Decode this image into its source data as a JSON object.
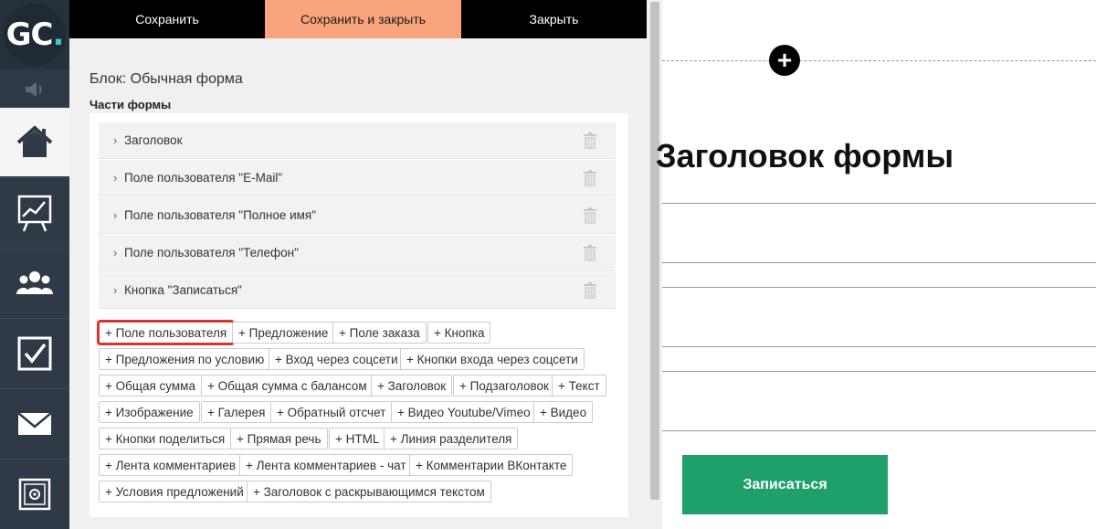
{
  "logo": {
    "text_main": "GC",
    "text_dot": "."
  },
  "tabs": {
    "save": "Сохранить",
    "save_close": "Сохранить и закрыть",
    "close": "Закрыть"
  },
  "block_title": "Блок: Обычная форма",
  "parts_title": "Части формы",
  "parts": [
    "Заголовок",
    "Поле пользователя \"E-Mail\"",
    "Поле пользователя \"Полное имя\"",
    "Поле пользователя \"Телефон\"",
    "Кнопка \"Записаться\""
  ],
  "chips": [
    "+ Поле пользователя",
    "+ Предложение",
    "+ Поле заказа",
    "+ Кнопка",
    "+ Предложения по условию",
    "+ Вход через соцсети",
    "+ Кнопки входа через соцсети",
    "+ Общая сумма",
    "+ Общая сумма с балансом",
    "+ Заголовок",
    "+ Подзаголовок",
    "+ Текст",
    "+ Изображение",
    "+ Галерея",
    "+ Обратный отсчет",
    "+ Видео Youtube/Vimeo",
    "+ Видео",
    "+ Кнопки поделиться",
    "+ Прямая речь",
    "+ HTML",
    "+ Линия разделителя",
    "+ Лента комментариев",
    "+ Лента комментариев - чат",
    "+ Комментарии ВКонтакте",
    "+ Условия предложений",
    "+ Заголовок с раскрывающимся текстом"
  ],
  "highlighted_chip": "+ Поле пользователя",
  "preview": {
    "heading": "Заголовок формы",
    "add_symbol": "+",
    "submit_label": "Записаться"
  },
  "colors": {
    "sidebar": "#2f3a46",
    "save_close_tab": "#f8a47c",
    "highlight_border": "#d9342b",
    "submit_button": "#1fa06a"
  },
  "sidebar_icons": [
    "speaker-icon",
    "home-icon",
    "chart-icon",
    "users-icon",
    "checkbox-icon",
    "mail-icon",
    "safe-icon"
  ]
}
